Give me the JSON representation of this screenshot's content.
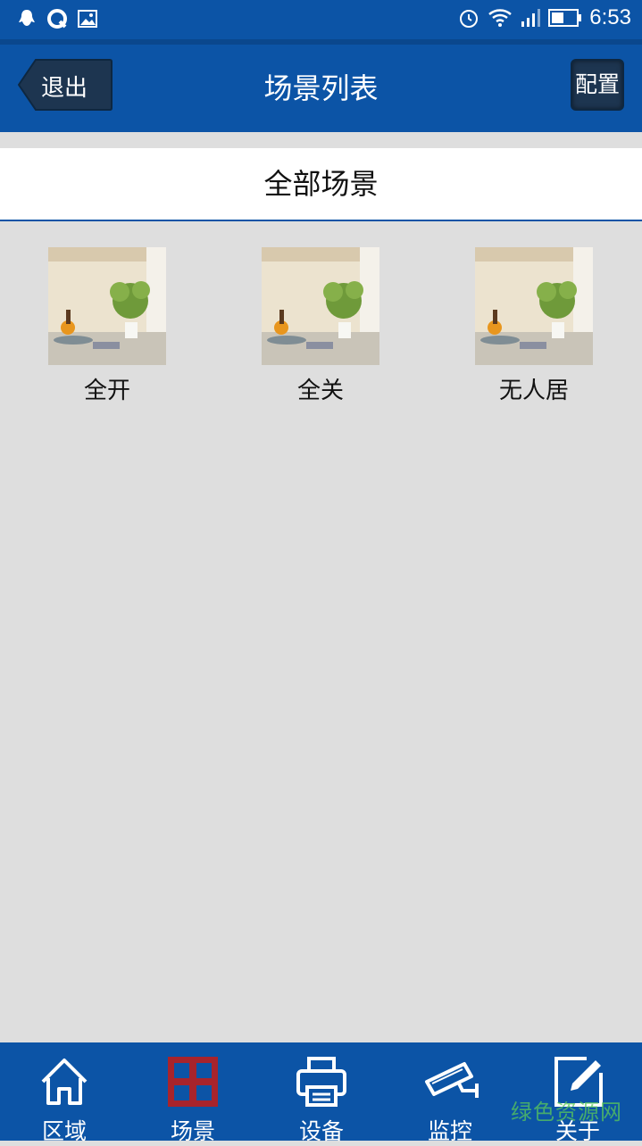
{
  "status_bar": {
    "time": "6:53",
    "left_icons": [
      "notification-bird-icon",
      "qq-icon",
      "image-icon"
    ],
    "right_icons": [
      "alarm-icon",
      "wifi-icon",
      "signal-icon",
      "battery-icon"
    ]
  },
  "header": {
    "back_label": "退出",
    "title": "场景列表",
    "config_label": "配置"
  },
  "section": {
    "label": "全部场景"
  },
  "scenes": [
    {
      "label": "全开"
    },
    {
      "label": "全关"
    },
    {
      "label": "无人居"
    }
  ],
  "nav": {
    "items": [
      {
        "label": "区域",
        "icon": "home-icon"
      },
      {
        "label": "场景",
        "icon": "grid-icon"
      },
      {
        "label": "设备",
        "icon": "printer-icon"
      },
      {
        "label": "监控",
        "icon": "camera-icon"
      },
      {
        "label": "关于",
        "icon": "edit-icon"
      }
    ]
  },
  "watermark": "绿色资源网",
  "colors": {
    "primary": "#0c54a6",
    "background": "#dedede",
    "active_nav": "#a8242c"
  }
}
